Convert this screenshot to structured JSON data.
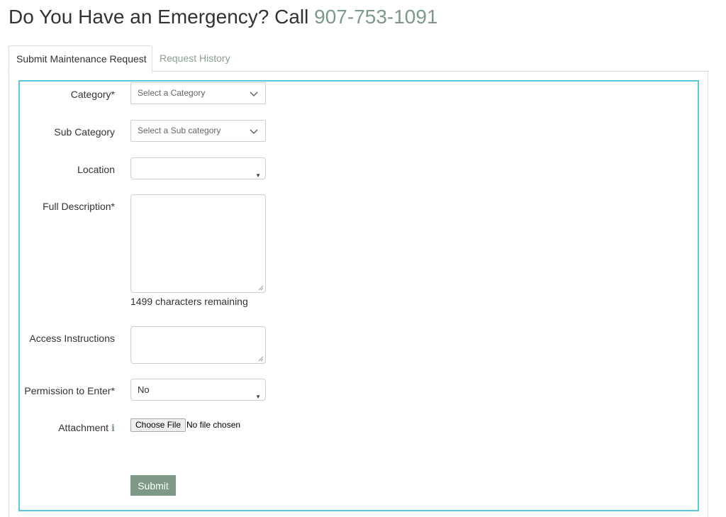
{
  "header": {
    "title_prefix": "Do You Have an Emergency? Call",
    "phone": "907-753-1091"
  },
  "tabs": [
    {
      "label": "Submit Maintenance Request",
      "active": true
    },
    {
      "label": "Request History",
      "active": false
    }
  ],
  "form": {
    "category": {
      "label": "Category*",
      "placeholder": "Select a Category"
    },
    "sub_category": {
      "label": "Sub Category",
      "placeholder": "Select a Sub category"
    },
    "location": {
      "label": "Location",
      "value": ""
    },
    "full_description": {
      "label": "Full Description*",
      "value": "",
      "helper": "1499 characters remaining"
    },
    "access_instructions": {
      "label": "Access Instructions",
      "value": ""
    },
    "permission_to_enter": {
      "label": "Permission to Enter*",
      "value": "No"
    },
    "attachment": {
      "label": "Attachment",
      "button_label": "Choose File",
      "status": "No file chosen"
    },
    "submit_label": "Submit"
  },
  "icons": {
    "dropdown": "chevron-down-icon",
    "select_arrow": "triangle-down-icon",
    "info": "info-icon"
  },
  "colors": {
    "accent": "#7e9a86",
    "panel_border": "#5bc6dc"
  }
}
